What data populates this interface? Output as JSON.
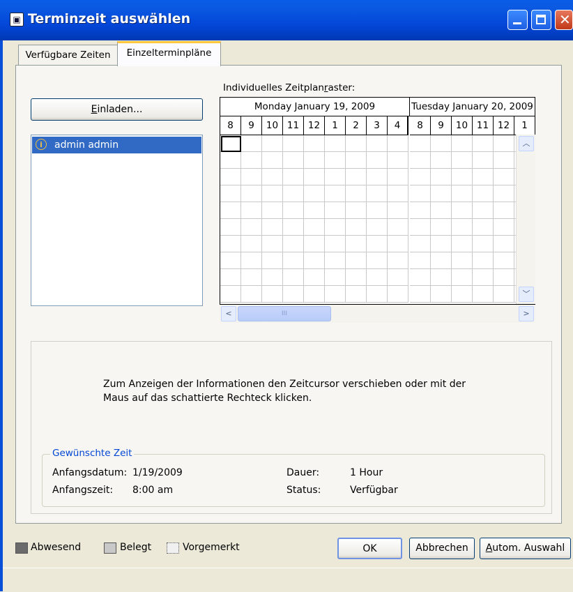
{
  "window": {
    "title": "Terminzeit auswählen"
  },
  "tabs": [
    {
      "label": "Verfügbare Zeiten",
      "selected": false
    },
    {
      "label": "Einzelterminpläne",
      "selected": true
    }
  ],
  "invite": {
    "label_first": "E",
    "label_rest": "inladen..."
  },
  "attendees": [
    {
      "name": "admin admin",
      "icon": "info-icon",
      "selected": true
    }
  ],
  "grid": {
    "label_pre": "Individuelles Zeitplan",
    "label_underlined": "r",
    "label_post": "aster:",
    "days": [
      {
        "label": "Monday January 19, 2009",
        "hours": [
          "8",
          "9",
          "10",
          "11",
          "12",
          "1",
          "2",
          "3",
          "4"
        ]
      },
      {
        "label": "Tuesday January 20, 2009",
        "hours": [
          "8",
          "9",
          "10",
          "11",
          "12",
          "1"
        ]
      }
    ],
    "visible_rows": 10,
    "cursor": {
      "day": 0,
      "hour": "8"
    }
  },
  "info": {
    "hint": "Zum Anzeigen der Informationen den Zeitcursor verschieben oder mit der Maus auf das schattierte Rechteck klicken.",
    "group_title": "Gewünschte Zeit",
    "start_date_label": "Anfangsdatum:",
    "start_date": "1/19/2009",
    "start_time_label": "Anfangszeit:",
    "start_time": "8:00 am",
    "duration_label": "Dauer:",
    "duration": "1 Hour",
    "status_label": "Status:",
    "status": "Verfügbar"
  },
  "legend": [
    {
      "label": "Abwesend",
      "color": "#6B6B6B"
    },
    {
      "label": "Belegt",
      "color": "#C8C8C8"
    },
    {
      "label": "Vorgemerkt",
      "color": "#F0F0F0"
    }
  ],
  "buttons": {
    "ok": "OK",
    "cancel": "Abbrechen",
    "auto_first": "A",
    "auto_rest": "utom. Auswahl"
  },
  "colors": {
    "title_bar": "#0A5CE8",
    "selection": "#316AC5",
    "group_title": "#0046D5",
    "active_tab": "#FFC83C"
  }
}
